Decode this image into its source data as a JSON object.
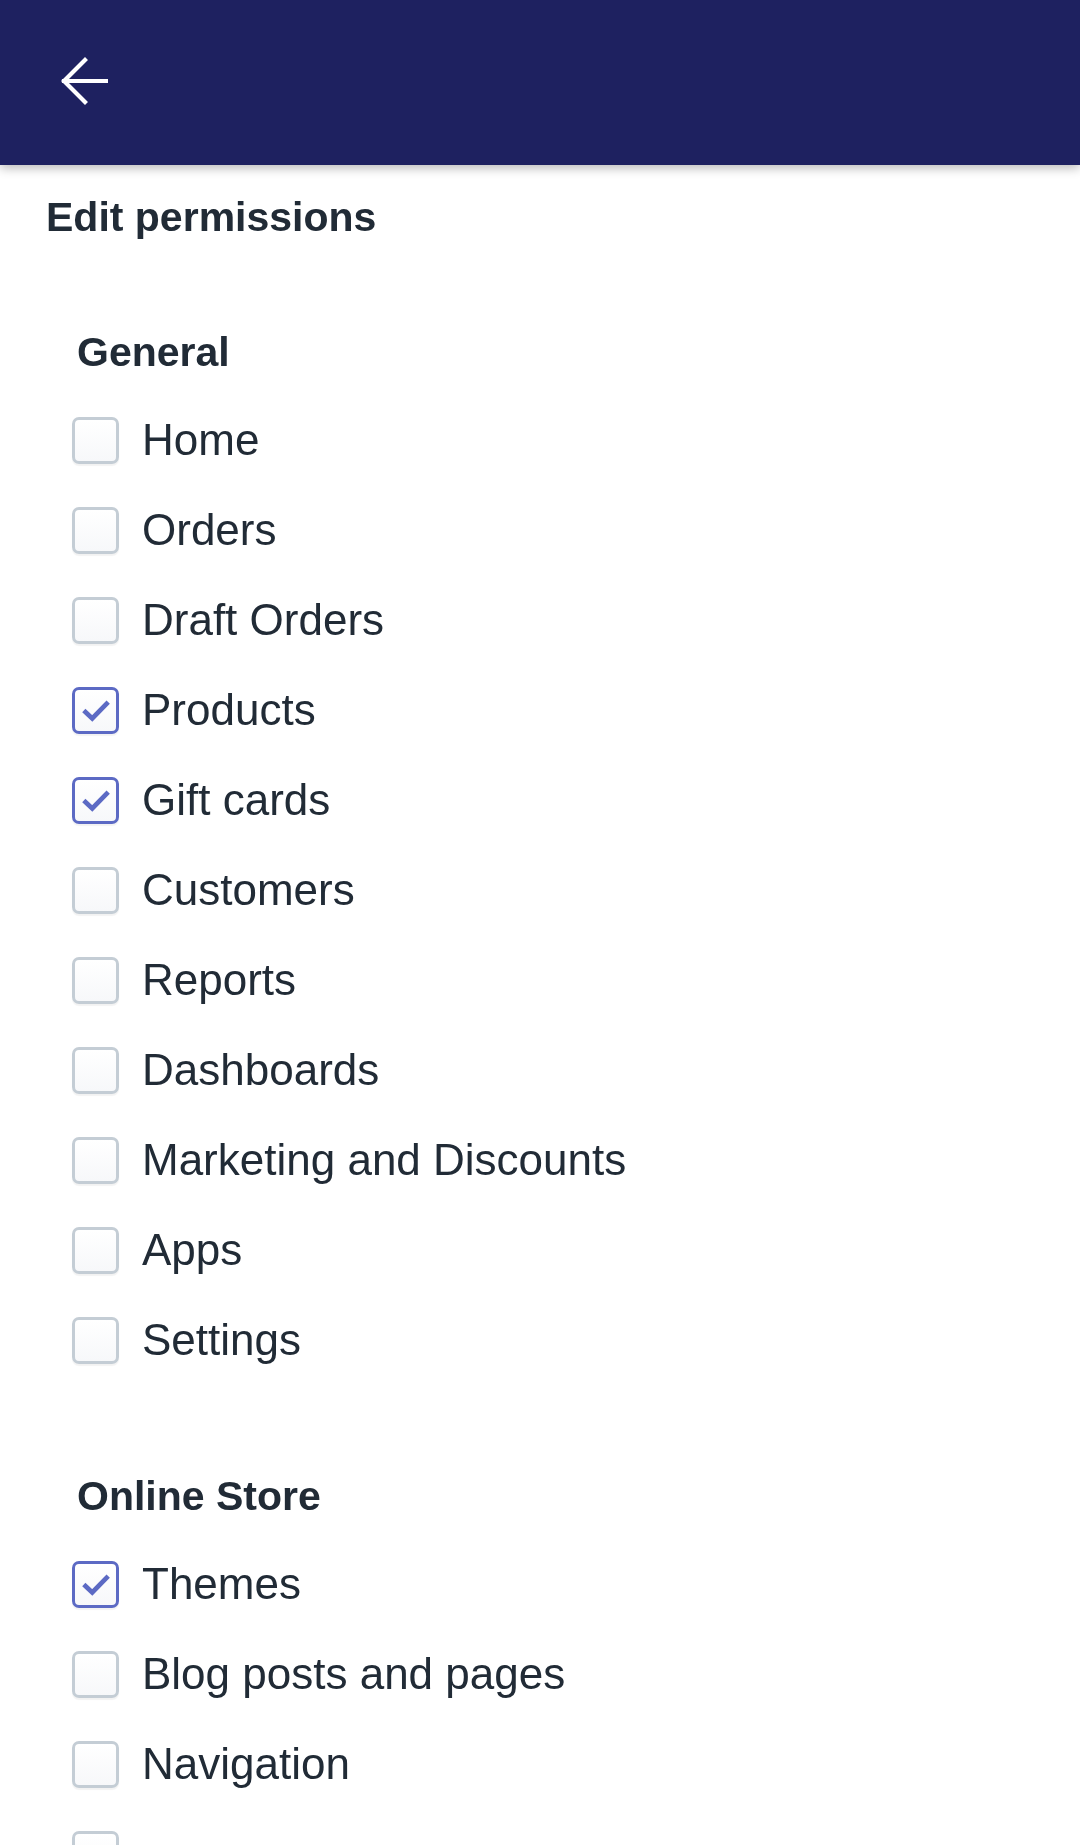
{
  "title": "Edit permissions",
  "sections": [
    {
      "title": "General",
      "items": [
        {
          "label": "Home",
          "checked": false
        },
        {
          "label": "Orders",
          "checked": false
        },
        {
          "label": "Draft Orders",
          "checked": false
        },
        {
          "label": "Products",
          "checked": true
        },
        {
          "label": "Gift cards",
          "checked": true
        },
        {
          "label": "Customers",
          "checked": false
        },
        {
          "label": "Reports",
          "checked": false
        },
        {
          "label": "Dashboards",
          "checked": false
        },
        {
          "label": "Marketing and Discounts",
          "checked": false
        },
        {
          "label": "Apps",
          "checked": false
        },
        {
          "label": "Settings",
          "checked": false
        }
      ]
    },
    {
      "title": "Online Store",
      "items": [
        {
          "label": "Themes",
          "checked": true
        },
        {
          "label": "Blog posts and pages",
          "checked": false
        },
        {
          "label": "Navigation",
          "checked": false
        },
        {
          "checked": false
        }
      ]
    }
  ]
}
